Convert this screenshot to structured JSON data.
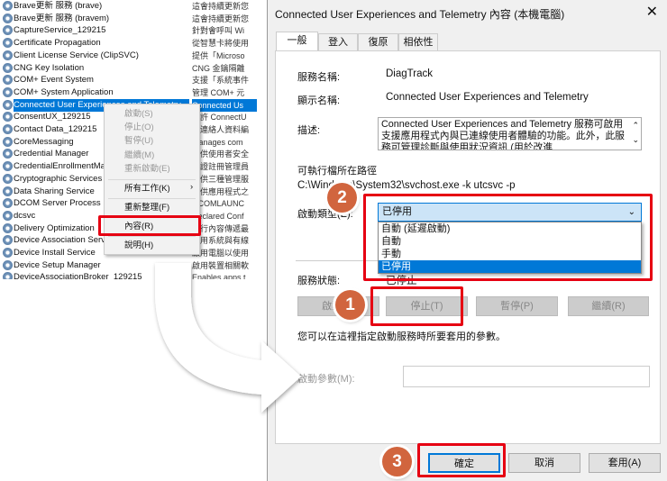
{
  "services": [
    {
      "name": "Brave更新 服務 (brave)",
      "desc": "這會持續更新您"
    },
    {
      "name": "Brave更新 服務 (bravem)",
      "desc": "這會持續更新您"
    },
    {
      "name": "CaptureService_129215",
      "desc": "針對會呼叫 Wi"
    },
    {
      "name": "Certificate Propagation",
      "desc": "從智慧卡將使用"
    },
    {
      "name": "Client License Service (ClipSVC)",
      "desc": "提供「Microso"
    },
    {
      "name": "CNG Key Isolation",
      "desc": "CNG 金鑰隔離"
    },
    {
      "name": "COM+ Event System",
      "desc": "支援「系統事件"
    },
    {
      "name": "COM+ System Application",
      "desc": "管理 COM+ 元"
    },
    {
      "name": "Connected User Experiences and Telemetry",
      "desc": "Connected Us"
    },
    {
      "name": "ConsentUX_129215",
      "desc": "允許 ConnectU"
    },
    {
      "name": "Contact Data_129215",
      "desc": "為連絡人資料編"
    },
    {
      "name": "CoreMessaging",
      "desc": "Manages com"
    },
    {
      "name": "Credential Manager",
      "desc": "提供使用者安全"
    },
    {
      "name": "CredentialEnrollmentManager",
      "desc": "憑證註冊管理員"
    },
    {
      "name": "Cryptographic Services",
      "desc": "提供三種管理服"
    },
    {
      "name": "Data Sharing Service",
      "desc": "提供應用程式之"
    },
    {
      "name": "DCOM Server Process Launcher",
      "desc": "DCOMLAUNC"
    },
    {
      "name": "dcsvc",
      "desc": "Declared Conf"
    },
    {
      "name": "Delivery Optimization",
      "desc": "執行內容傳遞最"
    },
    {
      "name": "Device Association Service",
      "desc": "啟用系統與有線"
    },
    {
      "name": "Device Install Service",
      "desc": "啟用電腦以使用"
    },
    {
      "name": "Device Setup Manager",
      "desc": "啟用裝置相關軟"
    },
    {
      "name": "DeviceAssociationBroker_129215",
      "desc": "Enables apps t"
    }
  ],
  "context_menu": {
    "start": "啟動(S)",
    "stop": "停止(O)",
    "pause": "暫停(U)",
    "resume": "繼續(M)",
    "restart": "重新啟動(E)",
    "all_tasks": "所有工作(K)",
    "refresh": "重新整理(F)",
    "properties": "內容(R)",
    "help": "說明(H)"
  },
  "dialog": {
    "title": "Connected User Experiences and Telemetry 內容 (本機電腦)",
    "tabs": [
      "一般",
      "登入",
      "復原",
      "相依性"
    ],
    "service_name_label": "服務名稱:",
    "service_name": "DiagTrack",
    "display_name_label": "顯示名稱:",
    "display_name": "Connected User Experiences and Telemetry",
    "desc_label": "描述:",
    "desc": "Connected User Experiences and Telemetry 服務可啟用支援應用程式內與已連線使用者體驗的功能。此外，此服務可管理診斷與使用狀況資訊 (用於改進",
    "path_label": "可執行檔所在路徑",
    "path": "C:\\Windows\\System32\\svchost.exe -k utcsvc -p",
    "startup_label": "啟動類型(E):",
    "startup_value": "已停用",
    "startup_options": [
      "自動 (延遲啟動)",
      "自動",
      "手動",
      "已停用"
    ],
    "status_label": "服務狀態:",
    "status": "已停止",
    "btn_start": "啟動(S)",
    "btn_stop": "停止(T)",
    "btn_pause": "暫停(P)",
    "btn_resume": "繼續(R)",
    "hint": "您可以在這裡指定啟動服務時所要套用的參數。",
    "params_label": "啟動參數(M):",
    "params_value": "",
    "ok": "確定",
    "cancel": "取消",
    "apply": "套用(A)"
  },
  "badges": [
    "1",
    "2",
    "3"
  ],
  "colors": {
    "highlight": "#e60012",
    "badge": "#d1653e",
    "selection": "#0078d7"
  }
}
